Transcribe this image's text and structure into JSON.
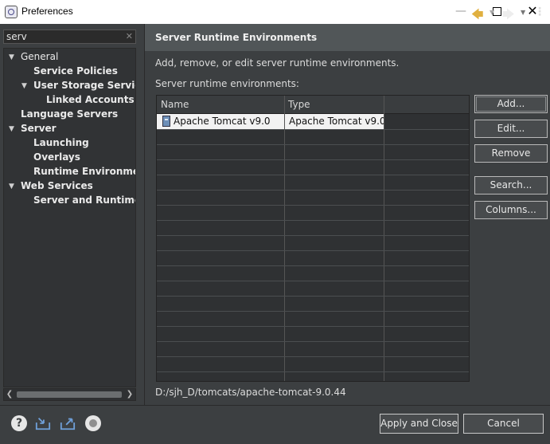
{
  "window": {
    "title": "Preferences",
    "controls": [
      "minimize",
      "maximize",
      "close"
    ]
  },
  "filter": {
    "value": "serv"
  },
  "tree": [
    {
      "label": "General",
      "expanded": true
    },
    {
      "label": "Service Policies"
    },
    {
      "label": "User Storage Service",
      "expanded": true
    },
    {
      "label": "Linked Accounts"
    },
    {
      "label": "Language Servers"
    },
    {
      "label": "Server",
      "expanded": true
    },
    {
      "label": "Launching"
    },
    {
      "label": "Overlays"
    },
    {
      "label": "Runtime Environments",
      "selected": true
    },
    {
      "label": "Web Services",
      "expanded": true
    },
    {
      "label": "Server and Runtime"
    }
  ],
  "page": {
    "title": "Server Runtime Environments",
    "description": "Add, remove, or edit server runtime environments.",
    "list_label": "Server runtime environments:",
    "columns": [
      "Name",
      "Type"
    ],
    "rows": [
      {
        "name": "Apache Tomcat v9.0",
        "type": "Apache Tomcat v9.0"
      }
    ],
    "location": "D:/sjh_D/tomcats/apache-tomcat-9.0.44"
  },
  "buttons": {
    "add": "Add...",
    "edit": "Edit...",
    "remove": "Remove",
    "search": "Search...",
    "columns": "Columns..."
  },
  "footer": {
    "apply_close": "Apply and Close",
    "cancel": "Cancel"
  },
  "colors": {
    "background": "#3c3f41",
    "header": "#515658",
    "back_arrow": "#e0b040",
    "selected_row": "#f2f2f2"
  },
  "icons": [
    "help-icon",
    "import-icon",
    "export-icon",
    "oomph-icon",
    "server-runtime-icon",
    "back-arrow-icon",
    "forward-arrow-icon",
    "view-menu-icon"
  ]
}
